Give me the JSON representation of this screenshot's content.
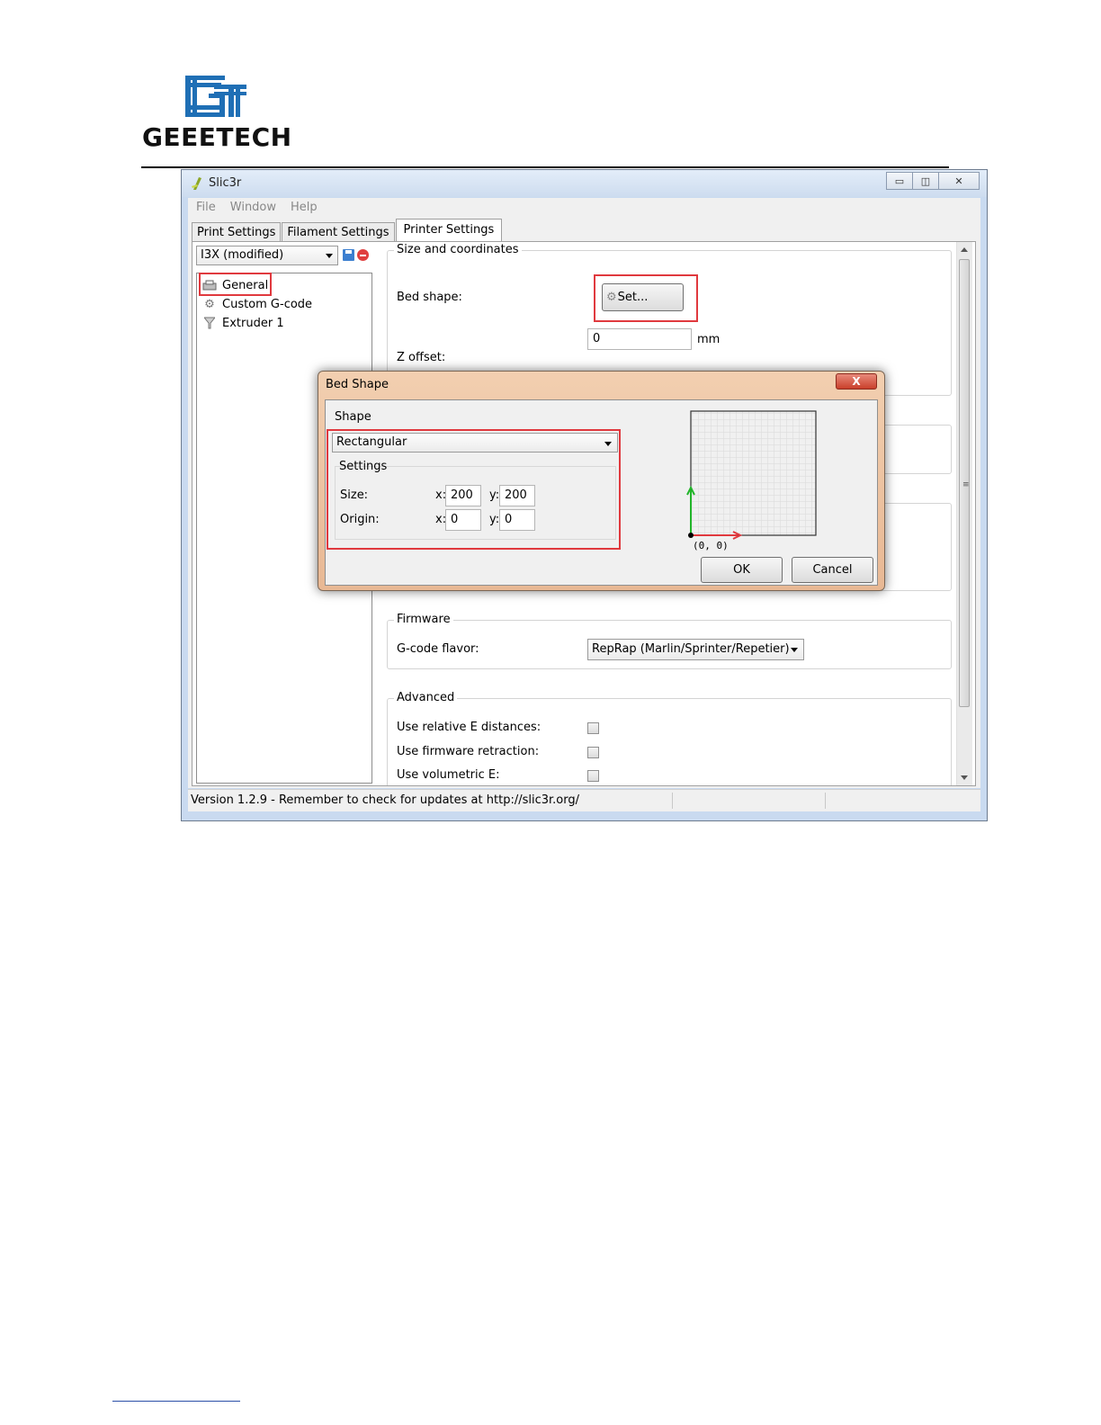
{
  "logo": {
    "text": "GEEETECH",
    "mark_letters": "GT",
    "color": "#1f6fb5"
  },
  "window": {
    "title": "Slic3r",
    "controls": [
      "minimize",
      "maximize",
      "close"
    ],
    "menu": [
      "File",
      "Window",
      "Help"
    ],
    "tabs": [
      "Print Settings",
      "Filament Settings",
      "Printer Settings"
    ],
    "active_tab": "Printer Settings",
    "preset": "I3X (modified)",
    "tree": [
      {
        "label": "General",
        "icon": "printer-icon"
      },
      {
        "label": "Custom G-code",
        "icon": "gear-icon"
      },
      {
        "label": "Extruder 1",
        "icon": "funnel-icon"
      }
    ],
    "size_coords": {
      "title": "Size and coordinates",
      "bed_shape_label": "Bed shape:",
      "set_button": "Set...",
      "z_offset_value": "0",
      "z_offset_unit": "mm",
      "z_offset_label": "Z offset:"
    },
    "firmware": {
      "title": "Firmware",
      "gcode_flavor_label": "G-code flavor:",
      "gcode_flavor_value": "RepRap (Marlin/Sprinter/Repetier)"
    },
    "advanced": {
      "title": "Advanced",
      "rows": [
        {
          "label": "Use relative E distances:",
          "checked": false
        },
        {
          "label": "Use firmware retraction:",
          "checked": false
        },
        {
          "label": "Use volumetric E:",
          "checked": false
        }
      ]
    },
    "status": "Version 1.2.9 - Remember to check for updates at http://slic3r.org/"
  },
  "dialog": {
    "title": "Bed Shape",
    "close_symbol": "X",
    "shape_label": "Shape",
    "shape_value": "Rectangular",
    "settings_label": "Settings",
    "size_label": "Size:",
    "origin_label": "Origin:",
    "x_label": "x:",
    "y_label": "y:",
    "size_x": "200",
    "size_y": "200",
    "origin_x": "0",
    "origin_y": "0",
    "origin_marker": "(0, 0)",
    "ok": "OK",
    "cancel": "Cancel"
  },
  "colors": {
    "highlight_red": "#e0393e",
    "axis_x": "#e0393e",
    "axis_y": "#22b52a"
  }
}
